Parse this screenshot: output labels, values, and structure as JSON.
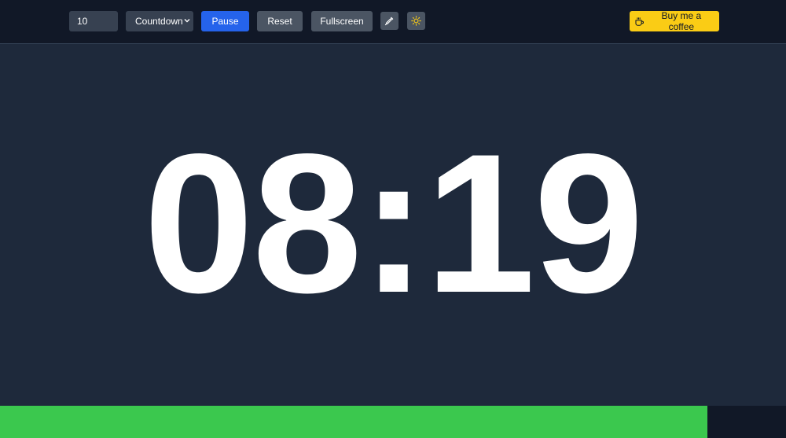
{
  "toolbar": {
    "minutes_value": "10",
    "mode_selected": "Countdown",
    "mode_options": [
      "Countdown"
    ],
    "pause_label": "Pause",
    "reset_label": "Reset",
    "fullscreen_label": "Fullscreen",
    "color_picker_icon": "eyedropper-icon",
    "theme_icon": "sun-icon",
    "coffee_label": "Buy me a coffee",
    "coffee_icon": "coffee-cup-icon"
  },
  "timer": {
    "display": "08:19"
  },
  "progress": {
    "fraction": 0.9
  },
  "colors": {
    "toolbar_bg": "#111827",
    "page_bg": "#1e293b",
    "pause_button": "#2563eb",
    "secondary_button": "#4b5563",
    "coffee_button": "#facc15",
    "progress_fill": "#3bc84e",
    "sun_icon": "#facc15"
  }
}
